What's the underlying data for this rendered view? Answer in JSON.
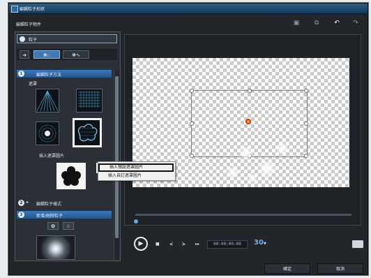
{
  "window": {
    "title": "編輯粒子形狀"
  },
  "toolbar": {
    "subtitle": "編輯粒子物件",
    "icons": [
      "copy-icon",
      "paste-icon",
      "undo-icon",
      "redo-icon"
    ]
  },
  "left": {
    "name_field": {
      "value": "粒子"
    },
    "mode_tabs": [
      {
        "label": "❋∴"
      },
      {
        "label": "❋∿"
      }
    ],
    "section1": {
      "number": "1",
      "label": "編輯粒子方法"
    },
    "subsection": {
      "label": "遮罩"
    },
    "insert_mask_label": "插入遮罩圖片",
    "section2": {
      "number": "2",
      "label": "編輯粒子樣式"
    },
    "section3": {
      "number": "3",
      "label": "新增/刪除粒子"
    }
  },
  "context_menu": {
    "items": [
      "插入預設遮罩圖片",
      "插入自訂遮罩圖片"
    ]
  },
  "transport": {
    "timecode": "00:00:00:00",
    "fps": "30"
  },
  "footer": {
    "ok_label": "確定",
    "cancel_label": "取消"
  },
  "colors": {
    "accent": "#3a78bd",
    "title_bar": "#2b5c86",
    "highlight_ring": "#e12d16"
  }
}
